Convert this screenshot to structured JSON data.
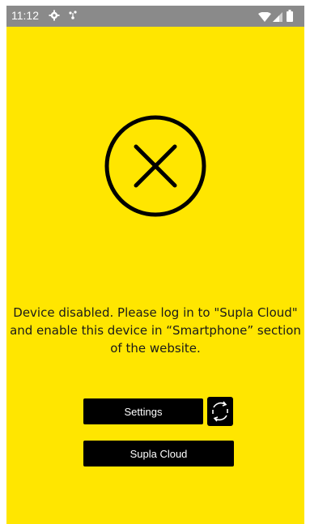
{
  "status_bar": {
    "time": "11:12",
    "icons": [
      "gear-icon",
      "notification-icon",
      "wifi-icon",
      "signal-icon",
      "battery-icon"
    ]
  },
  "main": {
    "icon": "disabled-x-circle-icon",
    "message": "Device disabled. Please log in to \"Supla Cloud\" and enable this device in “Smartphone” section of the website.",
    "settings_label": "Settings",
    "refresh_icon": "refresh-icon",
    "cloud_label": "Supla Cloud"
  },
  "colors": {
    "background": "#ffe600",
    "button": "#000000",
    "button_text": "#ffffff",
    "status_bar": "#8a8a8a"
  }
}
